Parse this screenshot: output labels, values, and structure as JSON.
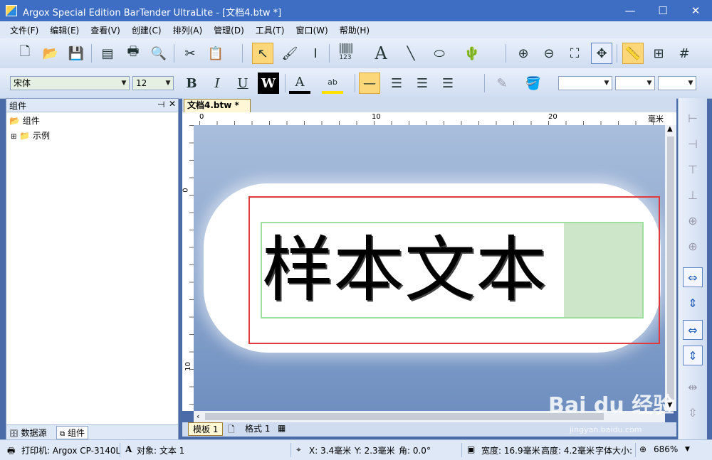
{
  "window": {
    "title": "Argox Special Edition BarTender UltraLite - [文档4.btw *]"
  },
  "menu": [
    "文件(F)",
    "编辑(E)",
    "查看(V)",
    "创建(C)",
    "排列(A)",
    "管理(D)",
    "工具(T)",
    "窗口(W)",
    "帮助(H)"
  ],
  "font": {
    "name": "宋体",
    "size": "12"
  },
  "toolbar": {
    "barcode_caption": "123",
    "bold": "B",
    "italic": "I",
    "underline": "U",
    "wordart": "W",
    "font_color": "A",
    "highlight": "ab"
  },
  "panel": {
    "title": "组件",
    "root": "组件",
    "child": "示例",
    "tab_datasource": "数据源",
    "tab_components": "组件"
  },
  "document": {
    "tab": "文档4.btw *",
    "close": "×"
  },
  "ruler": {
    "labels": [
      "0",
      "10",
      "20"
    ],
    "unit": "毫米",
    "left_labels": [
      "0",
      "10"
    ]
  },
  "label": {
    "text": "样本文本"
  },
  "bottom_tabs": [
    "模板 1",
    "格式 1"
  ],
  "status": {
    "printer": "打印机: Argox CP-3140L",
    "object": "对象: 文本 1",
    "x": "X: 3.4毫米",
    "y": "Y: 2.3毫米",
    "angle": "角: 0.0°",
    "width": "宽度: 16.9毫米",
    "height": "高度: 4.2毫米",
    "fontsize": "字体大小:",
    "zoom": "686%"
  },
  "watermark": {
    "brand": "Bai du 经验",
    "url": "jingyan.baidu.com"
  },
  "colors": {
    "title_bar": "#3d6ec3",
    "selection_red": "#e03a3a",
    "text_box_green": "#9ee09e",
    "toolbar_selected": "#fbd77a"
  }
}
